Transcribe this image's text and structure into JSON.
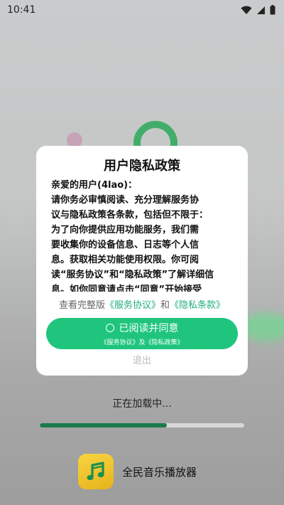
{
  "status_bar": {
    "time": "10:41",
    "icons": [
      "wifi-icon",
      "signal-icon",
      "battery-icon"
    ]
  },
  "dialog": {
    "title": "用户隐私政策",
    "body_lines": [
      "亲爱的用户(4lao)：",
      "请你务必审慎阅读、充分理解服务协",
      "议与隐私政策各条款，包括但不限于：",
      "为了向你提供应用功能服务，我们需",
      "要收集你的设备信息、日志等个人信",
      "息。获取相关功能使用权限。你可阅",
      "读“服务协议”和“隐私政策”了解详细信",
      "息。如你同意请点击“同意”开始接受"
    ],
    "links": {
      "prefix": "查看完整版",
      "service": "《服务协议》",
      "and": "和",
      "privacy": "《隐私条款》"
    },
    "agree_label": "已阅读并同意",
    "agree_sub": "《服务协议》及《隐私政策》",
    "exit_label": "退出"
  },
  "loading": {
    "text": "正在加载中...",
    "progress": 0.62
  },
  "app": {
    "name": "全民音乐播放器"
  },
  "colors": {
    "accent": "#1fc57d",
    "link": "#1faf7a",
    "progress": "#1a7a4e"
  }
}
